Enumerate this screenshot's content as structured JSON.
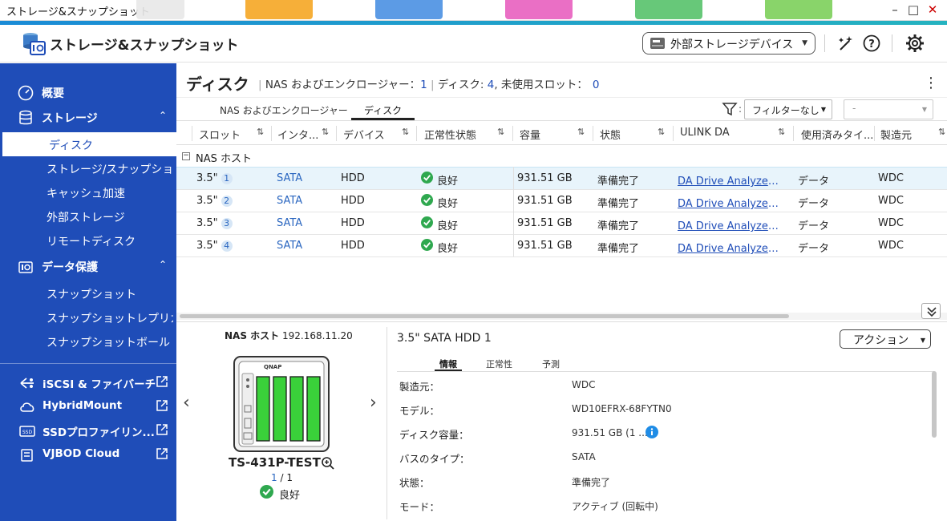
{
  "window": {
    "title": "ストレージ&スナップショット",
    "controls": [
      "minimize",
      "maximize",
      "close"
    ]
  },
  "header": {
    "app_title": "ストレージ&スナップショット",
    "external_device_label": "外部ストレージデバイス",
    "icons": [
      "wand-icon",
      "help-icon",
      "gear-icon"
    ]
  },
  "sidebar": {
    "overview": "概要",
    "storage": {
      "label": "ストレージ",
      "items": [
        "ディスク",
        "ストレージ/スナップショ...",
        "キャッシュ加速",
        "外部ストレージ",
        "リモートディスク"
      ]
    },
    "data_protection": {
      "label": "データ保護",
      "items": [
        "スナップショット",
        "スナップショットレプリカ",
        "スナップショットボールト"
      ]
    },
    "external_apps": [
      "iSCSI & ファイバーチ...",
      "HybridMount",
      "SSDプロファイリン...",
      "VJBOD Cloud"
    ]
  },
  "main": {
    "title": "ディスク",
    "summary": {
      "enclosure_label": "NAS およびエンクロージャー：",
      "enclosure_count": "1",
      "disk_label": "ディスク: ",
      "disk_count": "4",
      "unused_label": ", 未使用スロット：",
      "unused_count": "0"
    },
    "tabs": [
      "NAS およびエンクロージャー",
      "ディスク"
    ],
    "active_tab": "ディスク",
    "filter": {
      "selected": "フィルターなし",
      "second": "-"
    },
    "columns": [
      "スロット",
      "インタ...",
      "デバイス",
      "正常性状態",
      "容量",
      "状態",
      "ULINK DA",
      "使用済みタイ...",
      "製造元"
    ],
    "group_label": "NAS ホスト",
    "rows": [
      {
        "slot": "3.5\"",
        "num": "1",
        "iface": "SATA",
        "device": "HDD",
        "health": "良好",
        "capacity": "931.51 GB",
        "status": "準備完了",
        "ulink": "DA Drive Analyzer を...",
        "usage": "データ",
        "maker": "WDC"
      },
      {
        "slot": "3.5\"",
        "num": "2",
        "iface": "SATA",
        "device": "HDD",
        "health": "良好",
        "capacity": "931.51 GB",
        "status": "準備完了",
        "ulink": "DA Drive Analyzer を...",
        "usage": "データ",
        "maker": "WDC"
      },
      {
        "slot": "3.5\"",
        "num": "3",
        "iface": "SATA",
        "device": "HDD",
        "health": "良好",
        "capacity": "931.51 GB",
        "status": "準備完了",
        "ulink": "DA Drive Analyzer を...",
        "usage": "データ",
        "maker": "WDC"
      },
      {
        "slot": "3.5\"",
        "num": "4",
        "iface": "SATA",
        "device": "HDD",
        "health": "良好",
        "capacity": "931.51 GB",
        "status": "準備完了",
        "ulink": "DA Drive Analyzer を...",
        "usage": "データ",
        "maker": "WDC"
      }
    ]
  },
  "device_panel": {
    "host_label": "NAS ホスト",
    "ip": "192.168.11.20",
    "brand": "QNAP",
    "model": "TS-431P-TEST",
    "page_current": "1",
    "page_sep": " / ",
    "page_total": "1",
    "health": "良好"
  },
  "detail": {
    "title": "3.5\" SATA HDD 1",
    "action_label": "アクション",
    "tabs": [
      "情報",
      "正常性",
      "予測"
    ],
    "props": [
      {
        "label": "製造元：",
        "value": "WDC"
      },
      {
        "label": "モデル：",
        "value": "WD10EFRX-68FYTN0"
      },
      {
        "label": "ディスク容量：",
        "value": "931.51 GB (1 ..."
      },
      {
        "label": "バスのタイプ：",
        "value": "SATA"
      },
      {
        "label": "状態：",
        "value": "準備完了"
      },
      {
        "label": "モード：",
        "value": "アクティブ (回転中)"
      }
    ]
  },
  "colors": {
    "sidebar": "#1f4db8",
    "accent": "#1a8bd6",
    "ok": "#2fa84f",
    "drive": "#3ad13a"
  }
}
